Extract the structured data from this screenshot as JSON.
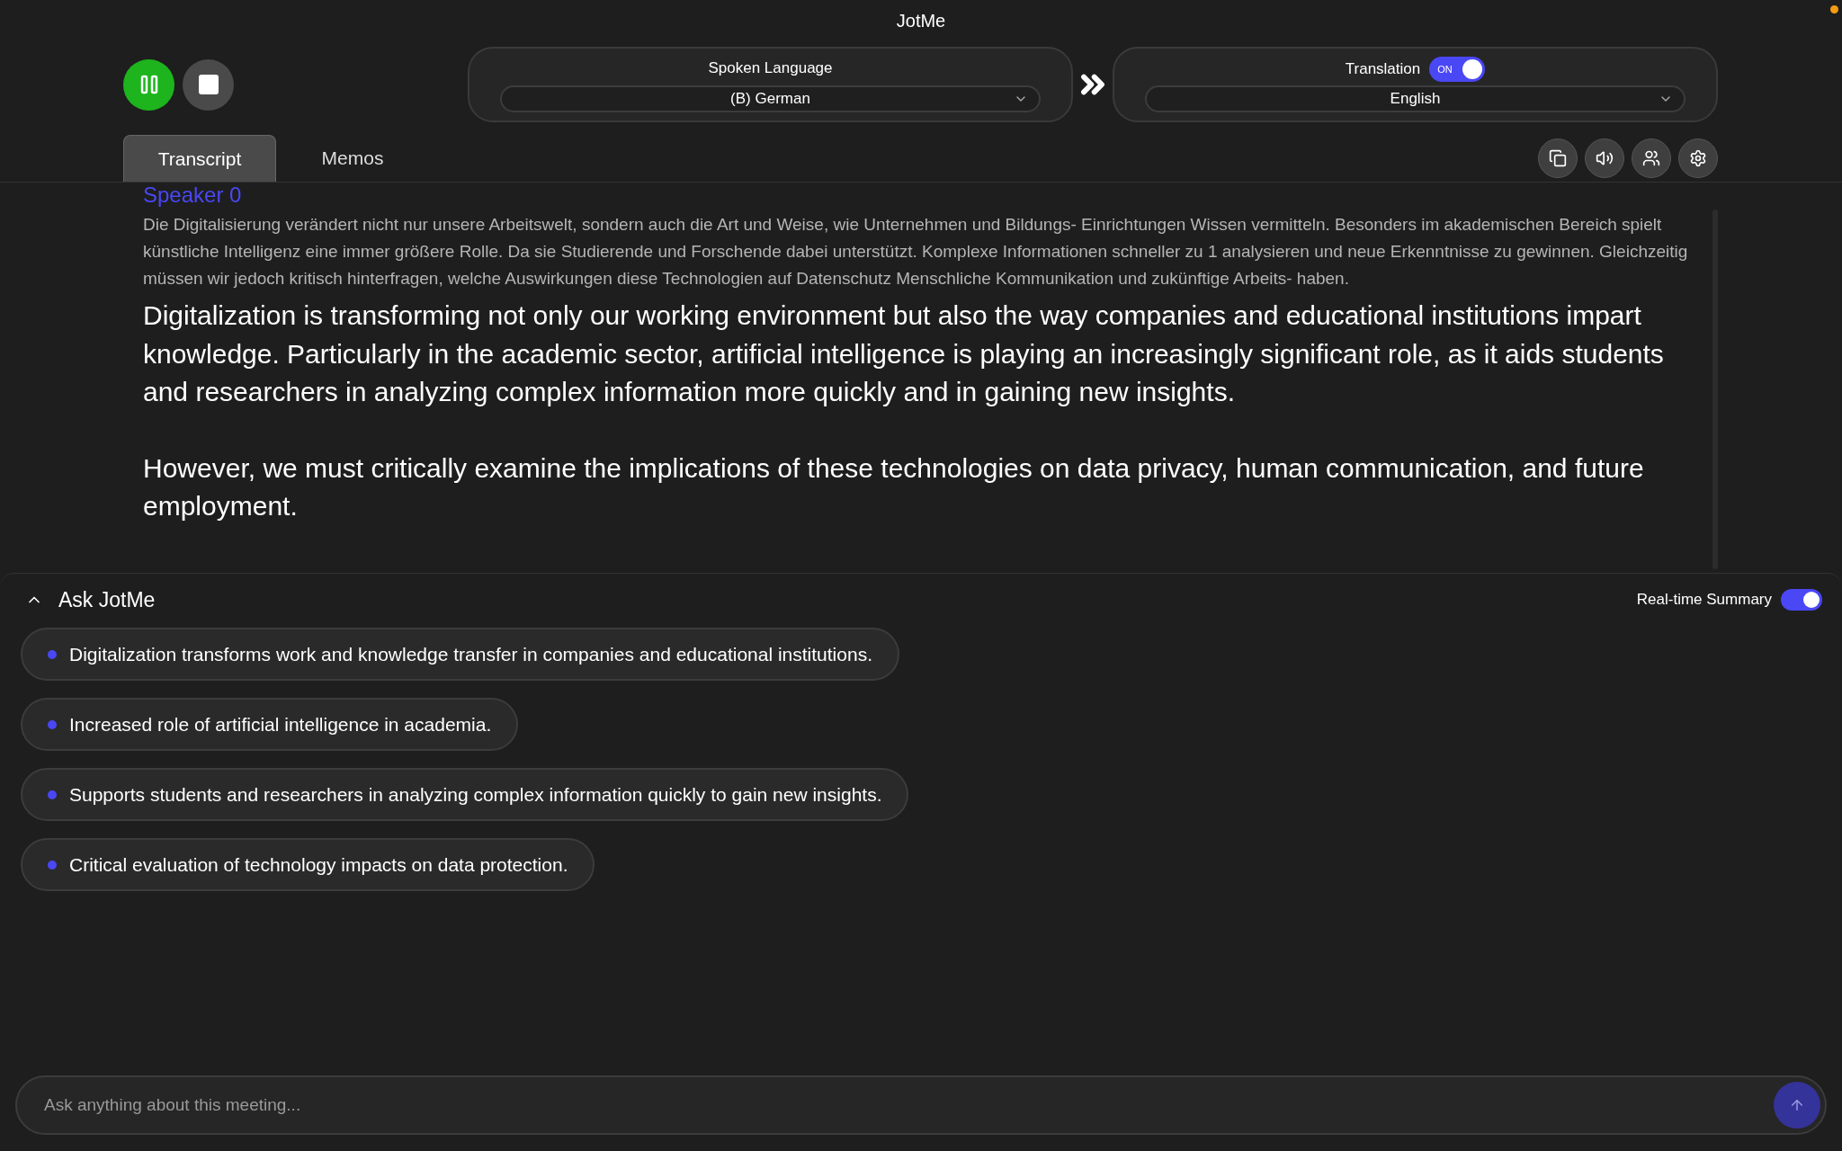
{
  "window": {
    "title": "JotMe"
  },
  "language_bar": {
    "spoken": {
      "label": "Spoken Language",
      "value": "(B) German"
    },
    "translation": {
      "label": "Translation",
      "toggle_text": "ON",
      "on": true,
      "value": "English"
    }
  },
  "tabs": [
    {
      "label": "Transcript",
      "selected": true
    },
    {
      "label": "Memos",
      "selected": false
    }
  ],
  "transcript": {
    "speaker": "Speaker 0",
    "original": "Die Digitalisierung verändert nicht nur unsere Arbeitswelt, sondern auch die Art und Weise, wie Unternehmen und Bildungs- Einrichtungen Wissen vermitteln. Besonders im akademischen Bereich spielt künstliche Intelligenz eine immer größere Rolle. Da sie Studierende und Forschende dabei unterstützt. Komplexe Informationen schneller zu 1 analysieren und neue Erkenntnisse zu gewinnen. Gleichzeitig müssen wir jedoch kritisch hinterfragen, welche Auswirkungen diese Technologien auf Datenschutz Menschliche Kommunikation und zukünftige Arbeits- haben.",
    "translation": [
      "Digitalization is transforming not only our working environment but also the way companies and educational institutions impart knowledge. Particularly in the academic sector, artificial intelligence is playing an increasingly significant role, as it aids students and researchers in analyzing complex information more quickly and in gaining new insights.",
      "However, we must critically examine the implications of these technologies on data privacy, human communication, and future employment."
    ]
  },
  "ask": {
    "title": "Ask JotMe",
    "expanded": true,
    "summary_label": "Real-time Summary",
    "summary_on": true,
    "points": [
      "Digitalization transforms work and knowledge transfer in companies and educational institutions.",
      "Increased role of artificial intelligence in academia.",
      "Supports students and researchers in analyzing complex information quickly to gain new insights.",
      "Critical evaluation of technology impacts on data protection."
    ],
    "input": {
      "placeholder": "Ask anything about this meeting..."
    }
  }
}
